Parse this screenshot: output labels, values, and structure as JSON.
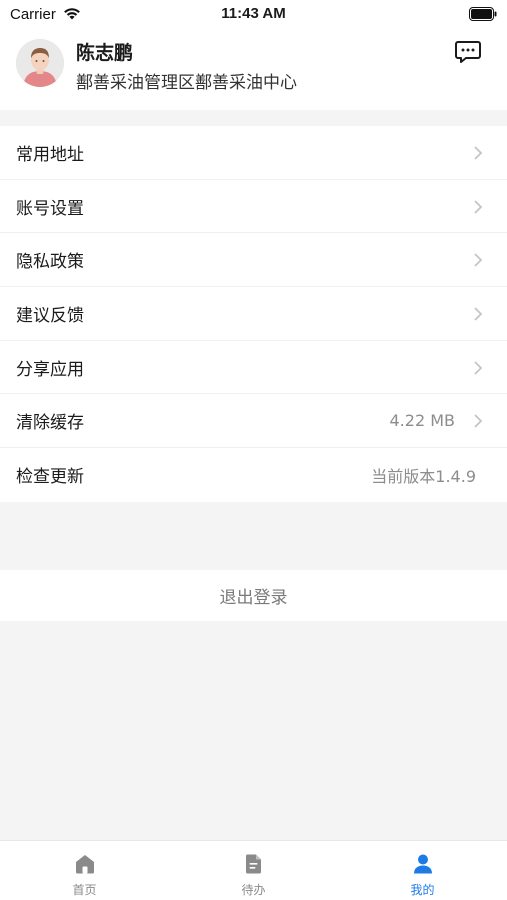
{
  "status_bar": {
    "carrier": "Carrier",
    "time": "11:43 AM",
    "icons": [
      "wifi-icon",
      "battery-icon"
    ]
  },
  "profile": {
    "name": "陈志鹏",
    "org": "鄯善采油管理区鄯善采油中心",
    "avatar_icon": "avatar-person-icon",
    "message_icon": "message-icon"
  },
  "menu": {
    "items": [
      {
        "label": "常用地址",
        "value": "",
        "icon": "chevron-right-icon"
      },
      {
        "label": "账号设置",
        "value": "",
        "icon": "chevron-right-icon"
      },
      {
        "label": "隐私政策",
        "value": "",
        "icon": "chevron-right-icon"
      },
      {
        "label": "建议反馈",
        "value": "",
        "icon": "chevron-right-icon"
      },
      {
        "label": "分享应用",
        "value": "",
        "icon": "chevron-right-icon"
      },
      {
        "label": "清除缓存",
        "value": "4.22 MB",
        "icon": "chevron-right-icon"
      },
      {
        "label": "检查更新",
        "value": "当前版本1.4.9",
        "icon": ""
      }
    ]
  },
  "logout": {
    "label": "退出登录"
  },
  "tab_bar": {
    "tabs": [
      {
        "label": "首页",
        "icon": "home-icon",
        "active": false
      },
      {
        "label": "待办",
        "icon": "document-icon",
        "active": false
      },
      {
        "label": "我的",
        "icon": "user-icon",
        "active": true
      }
    ],
    "active_color": "#1e7be6",
    "inactive_color": "#8a8a8a"
  }
}
